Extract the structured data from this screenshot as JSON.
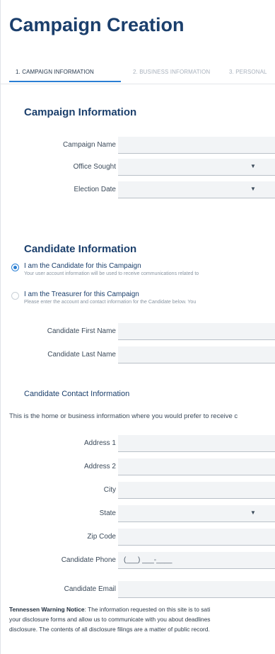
{
  "page": {
    "title": "Campaign Creation"
  },
  "tabs": [
    {
      "label": "1. CAMPAIGN INFORMATION",
      "active": true
    },
    {
      "label": "2. BUSINESS INFORMATION",
      "active": false
    },
    {
      "label": "3. PERSONAL",
      "active": false
    }
  ],
  "campaign_information": {
    "heading": "Campaign Information",
    "fields": [
      {
        "label": "Campaign Name",
        "value": "",
        "type": "text"
      },
      {
        "label": "Office Sought",
        "value": "",
        "type": "select"
      },
      {
        "label": "Election Date",
        "value": "",
        "type": "select"
      }
    ]
  },
  "candidate_information": {
    "heading": "Candidate Information",
    "options": [
      {
        "title": "I am the Candidate for this Campaign",
        "description": "Your user account information will be used to receive communications related to",
        "checked": true
      },
      {
        "title": "I am the Treasurer for this Campaign",
        "description": "Please enter the account and contact information for the Candidate below. You",
        "checked": false
      }
    ],
    "fields": [
      {
        "label": "Candidate First Name",
        "value": ""
      },
      {
        "label": "Candidate Last Name",
        "value": ""
      }
    ]
  },
  "contact_information": {
    "heading": "Candidate Contact Information",
    "intro": "This is the home or business information where you would prefer to receive c",
    "fields": [
      {
        "label": "Address 1",
        "value": "",
        "type": "text"
      },
      {
        "label": "Address 2",
        "value": "",
        "type": "text"
      },
      {
        "label": "City",
        "value": "",
        "type": "text"
      },
      {
        "label": "State",
        "value": "",
        "type": "select"
      },
      {
        "label": "Zip Code",
        "value": "",
        "type": "text"
      },
      {
        "label": "Candidate Phone",
        "value": "(___) ___-____",
        "type": "text"
      },
      {
        "label": "Candidate Email",
        "value": "",
        "type": "text"
      }
    ]
  },
  "warning": {
    "title": "Tennessen Warning Notice",
    "line1": ":  The information requested on this site is to sati",
    "line2": "your disclosure forms and allow us to communicate with you about deadlines",
    "line3": "disclosure. The contents of all disclosure filings are a matter of public record."
  },
  "colors": {
    "heading": "#1b3f6c",
    "accent": "#2a7fd4",
    "field_bg": "#f2f4f6"
  }
}
